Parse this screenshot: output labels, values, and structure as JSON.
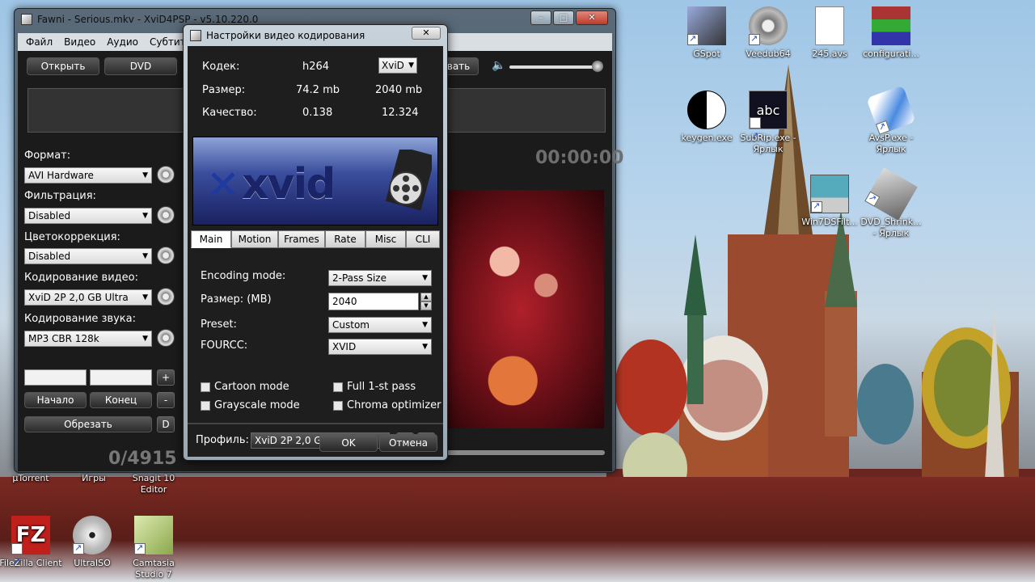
{
  "main_window": {
    "title": "Fawni - Serious.mkv - XviD4PSP - v5.10.220.0",
    "controls": [
      "–",
      "□",
      "✕"
    ],
    "menu": [
      "Файл",
      "Видео",
      "Аудио",
      "Субтитры"
    ],
    "toolbar": {
      "open": "Открыть",
      "dvd": "DVD",
      "save_partial": "вать"
    },
    "timecode": "00:00:00",
    "left": {
      "format_label": "Формат:",
      "format_value": "AVI Hardware",
      "filter_label": "Фильтрация:",
      "filter_value": "Disabled",
      "color_label": "Цветокоррекция:",
      "color_value": "Disabled",
      "video_label": "Кодирование видео:",
      "video_value": "XviD 2P 2,0 GB Ultra",
      "audio_label": "Кодирование звука:",
      "audio_value": "MP3 CBR 128k",
      "plus": "+",
      "minus": "-",
      "start": "Начало",
      "end": "Конец",
      "cut": "Обрезать",
      "d": "D"
    },
    "counter": "0/4915"
  },
  "dialog": {
    "title": "Настройки видео кодирования",
    "close": "✕",
    "codec_label": "Кодек:",
    "codec_value": "h264",
    "codec_combo": "XviD",
    "size_label": "Размер:",
    "size_value1": "74.2 mb",
    "size_value2": "2040 mb",
    "quality_label": "Качество:",
    "quality_value1": "0.138",
    "quality_value2": "12.324",
    "banner_text": "xvid",
    "tabs": [
      "Main",
      "Motion",
      "Frames",
      "Rate",
      "Misc",
      "CLI"
    ],
    "encoding_mode_label": "Encoding mode:",
    "encoding_mode_value": "2-Pass Size",
    "size_mb_label": "Размер: (MB)",
    "size_mb_value": "2040",
    "preset_label": "Preset:",
    "preset_value": "Custom",
    "fourcc_label": "FOURCC:",
    "fourcc_value": "XVID",
    "cartoon": "Cartoon mode",
    "full1st": "Full 1-st pass",
    "grayscale": "Grayscale mode",
    "chroma": "Chroma optimizer",
    "profile_label": "Профиль:",
    "profile_value": "XviD 2P 2,0 GB Ultra",
    "plus": "+",
    "minus": "-",
    "ok": "OK",
    "cancel": "Отмена"
  },
  "desktop": {
    "icons": [
      {
        "label": "GSpot"
      },
      {
        "label": "Veedub64"
      },
      {
        "label": "245.avs"
      },
      {
        "label": "configurati..."
      },
      {
        "label": "keygen.exe"
      },
      {
        "label": "SubRip.exe - Ярлык"
      },
      {
        "label": "AvsP.exe - Ярлык"
      },
      {
        "label": "Win7DSFilt..."
      },
      {
        "label": "DVD_Shrink... - Ярлык"
      },
      {
        "label": "µTorrent"
      },
      {
        "label": "Игры"
      },
      {
        "label": "Snagit 10 Editor"
      },
      {
        "label": "FileZilla Client"
      },
      {
        "label": "UltraISO"
      },
      {
        "label": "Camtasia Studio 7"
      }
    ]
  }
}
